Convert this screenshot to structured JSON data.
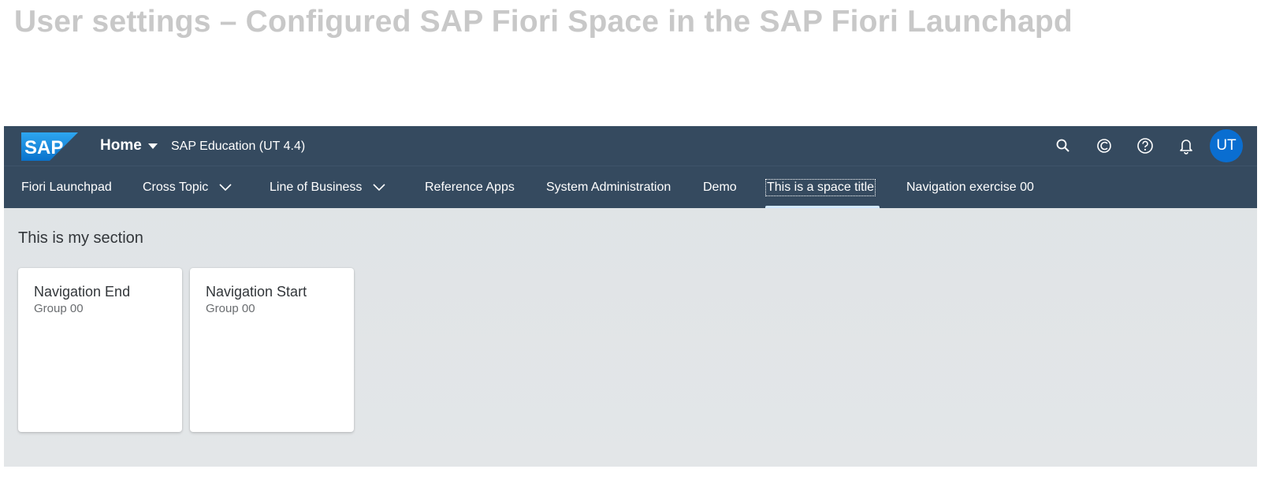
{
  "slide": {
    "title": "User settings – Configured SAP Fiori Space in the SAP Fiori Launchapd"
  },
  "shell": {
    "logo_text": "SAP",
    "home_label": "Home",
    "system_title": "SAP Education (UT 4.4)",
    "actions": [
      "search-icon",
      "copilot-icon",
      "help-icon",
      "notification-bell-icon"
    ],
    "avatar_initials": "UT"
  },
  "tabs": [
    {
      "label": "Fiori Launchpad",
      "has_dropdown": false
    },
    {
      "label": "Cross Topic",
      "has_dropdown": true
    },
    {
      "label": "Line of Business",
      "has_dropdown": true
    },
    {
      "label": "Reference Apps",
      "has_dropdown": false
    },
    {
      "label": "System Administration",
      "has_dropdown": false
    },
    {
      "label": "Demo",
      "has_dropdown": false
    },
    {
      "label": "This is a space title",
      "has_dropdown": false,
      "selected": true
    },
    {
      "label": "Navigation exercise 00",
      "has_dropdown": false
    }
  ],
  "section": {
    "title": "This is my section",
    "tiles": [
      {
        "title": "Navigation End",
        "subtitle": "Group 00"
      },
      {
        "title": "Navigation Start",
        "subtitle": "Group 00"
      }
    ]
  },
  "colors": {
    "shell_bg": "#354a5f",
    "content_bg": "#e1e4e7",
    "avatar_bg": "#0a6ed1",
    "title_gray": "#c8c8c8"
  }
}
